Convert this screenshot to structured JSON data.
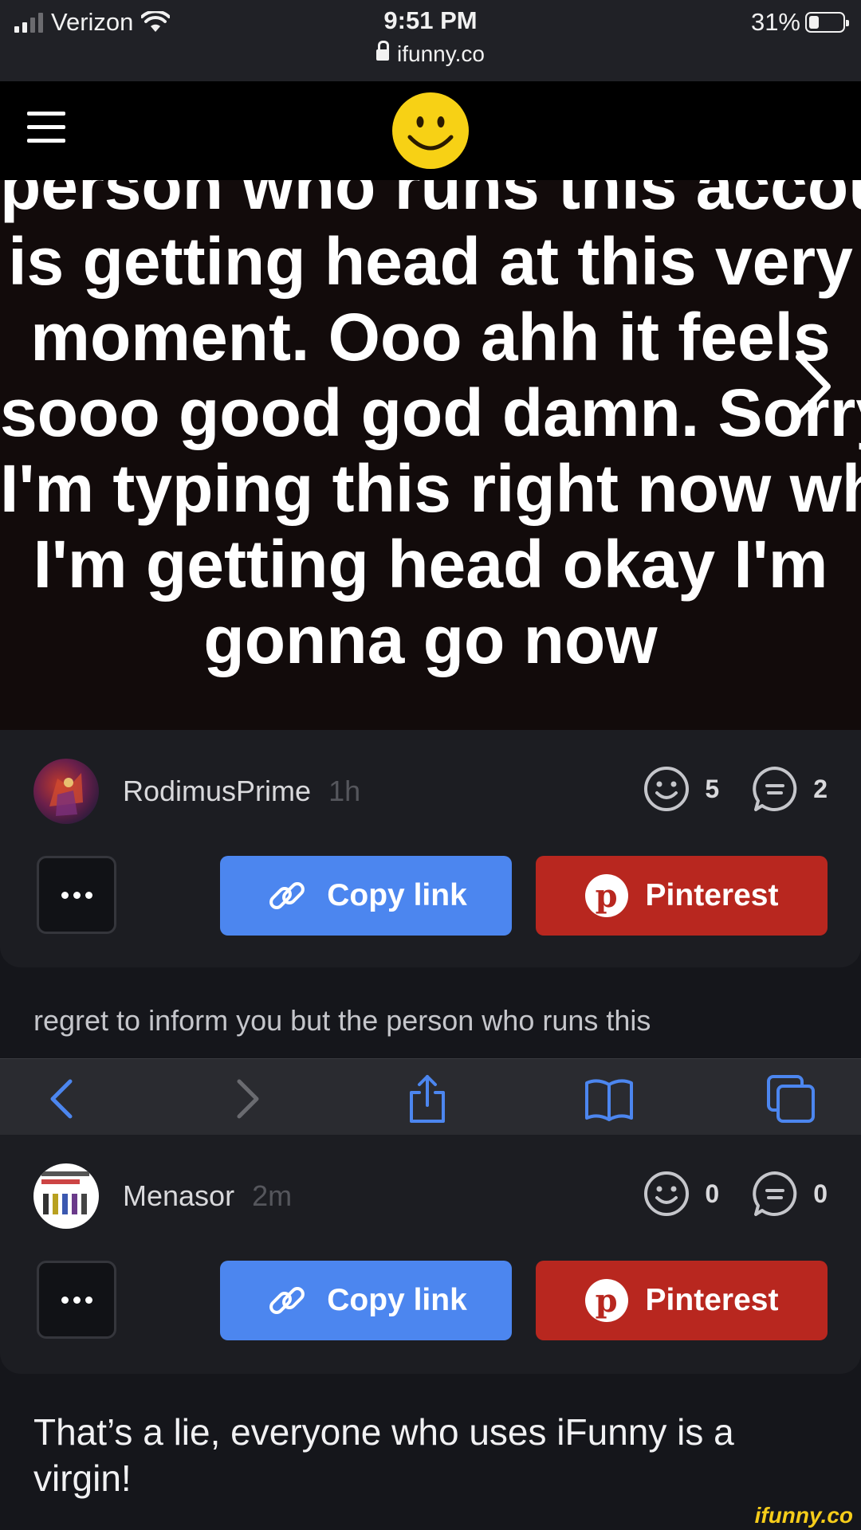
{
  "status_bar": {
    "carrier": "Verizon",
    "time": "9:51 PM",
    "url": "ifunny.co",
    "battery": "31%",
    "battery_level": 0.31
  },
  "header": {
    "menu_icon": "hamburger-icon",
    "logo_icon": "smiley-logo-icon"
  },
  "meme": {
    "lines": [
      "person who runs this account",
      "is getting head at this very",
      "moment. Ooo ahh it feels",
      "sooo good god damn. Sorry",
      "I'm typing this right now while",
      "I'm getting head okay I'm",
      "gonna go now"
    ],
    "next_icon": "chevron-right-icon"
  },
  "posts": [
    {
      "username": "RodimusPrime",
      "time": "1h",
      "smiles": "5",
      "comments": "2",
      "more_label": "•••",
      "copy_label": "Copy link",
      "pinterest_label": "Pinterest",
      "comment_text": "regret to inform you but the person who runs this"
    },
    {
      "username": "Menasor",
      "time": "2m",
      "smiles": "0",
      "comments": "0",
      "more_label": "•••",
      "copy_label": "Copy link",
      "pinterest_label": "Pinterest",
      "comment_text": "That’s a lie, everyone who uses iFunny is a virgin!"
    }
  ],
  "toolbar": {
    "items": [
      "back-icon",
      "forward-icon",
      "share-icon",
      "bookmarks-icon",
      "tabs-icon"
    ]
  },
  "watermark": "ifunny.co",
  "colors": {
    "accent_blue": "#4c86ef",
    "pinterest_red": "#b8271f",
    "logo_yellow": "#f7d115"
  }
}
